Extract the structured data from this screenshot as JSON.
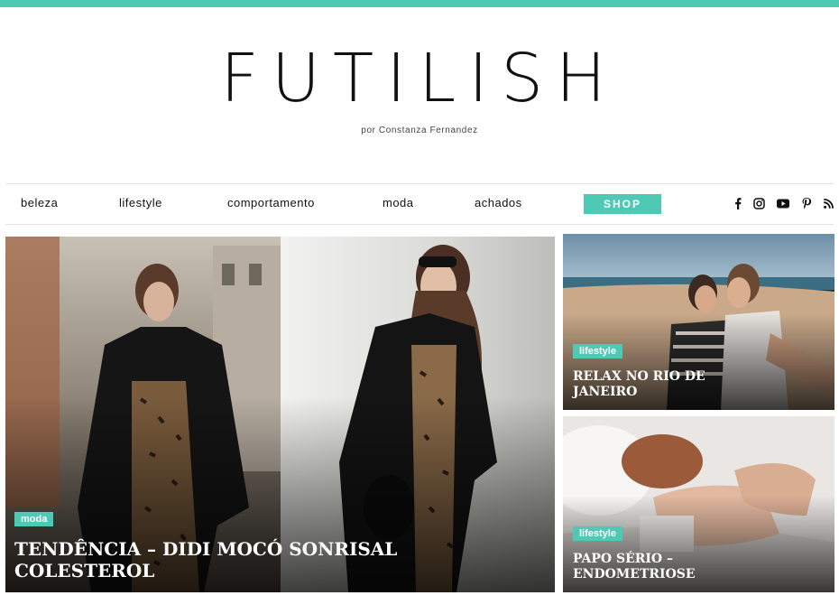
{
  "site": {
    "logo": "FUTILISH",
    "byline": "por Constanza Fernandez",
    "accent": "#4ec9b4"
  },
  "nav": {
    "items": [
      {
        "label": "beleza"
      },
      {
        "label": "lifestyle"
      },
      {
        "label": "comportamento"
      },
      {
        "label": "moda"
      },
      {
        "label": "achados"
      }
    ],
    "shop_label": "SHOP",
    "social": [
      "facebook-icon",
      "instagram-icon",
      "youtube-icon",
      "pinterest-icon",
      "rss-icon"
    ]
  },
  "posts": [
    {
      "tag": "moda",
      "title": "TENDÊNCIA – DIDI MOCÓ SONRISAL COLESTEROL"
    },
    {
      "tag": "lifestyle",
      "title": "RELAX NO RIO DE JANEIRO"
    },
    {
      "tag": "lifestyle",
      "title": "PAPO SÉRIO – ENDOMETRIOSE"
    }
  ]
}
